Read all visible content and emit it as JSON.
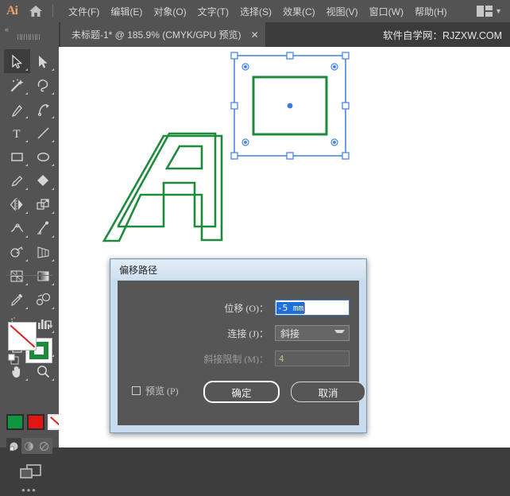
{
  "app": {
    "logo_text": "Ai",
    "home_icon": "home-icon",
    "workspace_icon": "workspace-layout-icon",
    "workspace_chevron": "chevron-down-icon"
  },
  "menubar": {
    "items": [
      {
        "label": "文件(F)",
        "name": "menu-file"
      },
      {
        "label": "编辑(E)",
        "name": "menu-edit"
      },
      {
        "label": "对象(O)",
        "name": "menu-object"
      },
      {
        "label": "文字(T)",
        "name": "menu-type"
      },
      {
        "label": "选择(S)",
        "name": "menu-select"
      },
      {
        "label": "效果(C)",
        "name": "menu-effect"
      },
      {
        "label": "视图(V)",
        "name": "menu-view"
      },
      {
        "label": "窗口(W)",
        "name": "menu-window"
      },
      {
        "label": "帮助(H)",
        "name": "menu-help"
      }
    ]
  },
  "tabbar": {
    "collapse_glyph": "«",
    "document_tab": {
      "title": "未标题-1* @ 185.9% (CMYK/GPU 预览)",
      "close_glyph": "✕"
    },
    "watermark": "软件自学网：RJZXW.COM"
  },
  "toolbar": {
    "tools": [
      {
        "name": "selection-tool",
        "active": true
      },
      {
        "name": "direct-selection-tool",
        "active": false
      },
      {
        "name": "magic-wand-tool",
        "active": false
      },
      {
        "name": "lasso-tool",
        "active": false
      },
      {
        "name": "pen-tool",
        "active": false
      },
      {
        "name": "curvature-tool",
        "active": false
      },
      {
        "name": "type-tool",
        "active": false
      },
      {
        "name": "line-segment-tool",
        "active": false
      },
      {
        "name": "rectangle-tool",
        "active": false
      },
      {
        "name": "ellipse-tool",
        "active": false
      },
      {
        "name": "paintbrush-tool",
        "active": false
      },
      {
        "name": "shaper-tool",
        "active": false
      },
      {
        "name": "reflect-tool",
        "active": false
      },
      {
        "name": "scale-tool",
        "active": false
      },
      {
        "name": "width-tool",
        "active": false
      },
      {
        "name": "free-transform-tool",
        "active": false
      },
      {
        "name": "shape-builder-tool",
        "active": false
      },
      {
        "name": "perspective-grid-tool",
        "active": false
      },
      {
        "name": "mesh-tool",
        "active": false
      },
      {
        "name": "gradient-tool",
        "active": false
      },
      {
        "name": "eyedropper-tool",
        "active": false
      },
      {
        "name": "blend-tool",
        "active": false
      },
      {
        "name": "symbol-sprayer-tool",
        "active": false
      },
      {
        "name": "column-graph-tool",
        "active": false
      },
      {
        "name": "artboard-tool",
        "active": false
      },
      {
        "name": "slice-tool",
        "active": false
      },
      {
        "name": "hand-tool",
        "active": false
      },
      {
        "name": "zoom-tool",
        "active": false
      }
    ],
    "fill_swatch": {
      "name": "fill-swatch",
      "value": "none"
    },
    "stroke_swatch": {
      "name": "stroke-swatch",
      "color": "#1e8b3c"
    },
    "swap_icon": "swap-fill-stroke-icon",
    "default_icon": "default-fill-stroke-icon",
    "mini_swatches": [
      {
        "name": "color-swatch-green",
        "color": "#0f9640",
        "selected": false
      },
      {
        "name": "color-swatch-red",
        "color": "#e01616",
        "selected": false
      },
      {
        "name": "color-swatch-none",
        "color": "none",
        "selected": true
      }
    ],
    "paint_modes": [
      {
        "name": "color-mode-button",
        "on": true
      },
      {
        "name": "gradient-mode-button",
        "on": false
      },
      {
        "name": "none-mode-button",
        "on": false
      }
    ],
    "screen_mode_icon": "screen-mode-icon",
    "more_tools_glyph": "•••"
  },
  "canvas": {
    "letter_a": {
      "name": "letter-a-artwork",
      "stroke": "#1e8b3c"
    },
    "selected_rect": {
      "name": "selected-rectangle-artwork",
      "stroke": "#1e8b3c",
      "selection_color": "#4a86e8"
    }
  },
  "dialog": {
    "title": "偏移路径",
    "fields": {
      "offset": {
        "label": "位移 (O)：",
        "value": "-5 mm",
        "name": "offset-input"
      },
      "joins": {
        "label": "连接 (J)：",
        "value": "斜接",
        "name": "joins-select"
      },
      "miter_limit": {
        "label": "斜接限制 (M)：",
        "value": "4",
        "name": "miter-limit-input",
        "disabled": true
      }
    },
    "preview": {
      "label": "预览 (P)",
      "checked": false,
      "name": "preview-checkbox"
    },
    "buttons": {
      "ok": {
        "label": "确定",
        "name": "ok-button"
      },
      "cancel": {
        "label": "取消",
        "name": "cancel-button"
      }
    }
  }
}
